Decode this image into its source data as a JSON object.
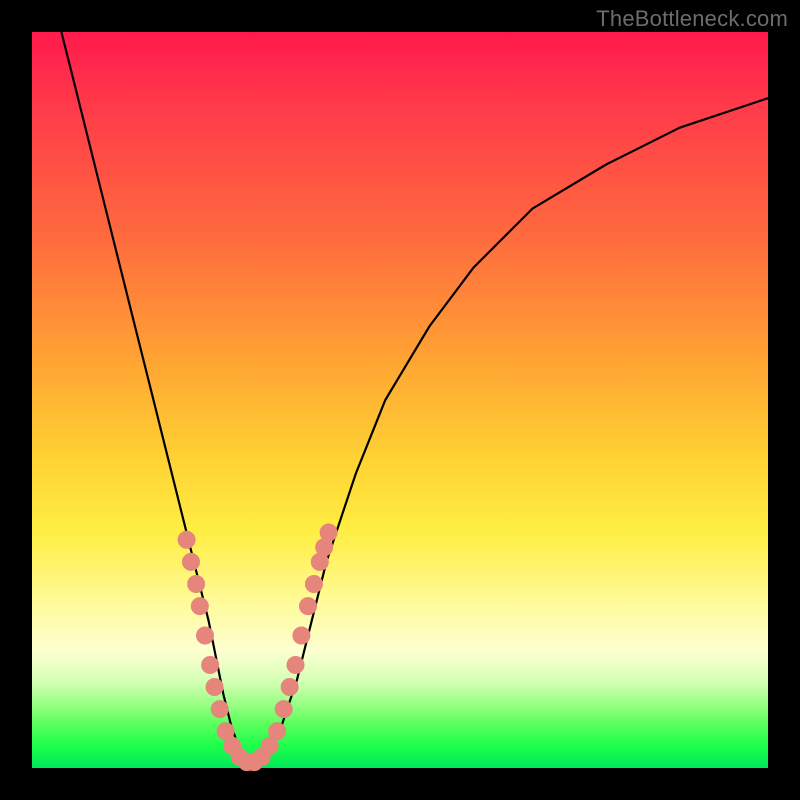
{
  "watermark": "TheBottleneck.com",
  "colors": {
    "page_bg": "#000000",
    "dot": "#e6857c",
    "curve": "#000000"
  },
  "chart_data": {
    "type": "line",
    "title": "",
    "xlabel": "",
    "ylabel": "",
    "xlim": [
      0,
      100
    ],
    "ylim": [
      0,
      100
    ],
    "grid": false,
    "legend": false,
    "series": [
      {
        "name": "bottleneck-curve",
        "x": [
          4,
          6,
          8,
          10,
          12,
          14,
          16,
          18,
          20,
          22,
          24,
          26,
          27,
          28,
          29,
          30,
          32,
          34,
          36,
          38,
          40,
          44,
          48,
          54,
          60,
          68,
          78,
          88,
          100
        ],
        "y": [
          100,
          92,
          84,
          76,
          68,
          60,
          52,
          44,
          36,
          28,
          20,
          10,
          6,
          3,
          1,
          0,
          2,
          6,
          12,
          20,
          28,
          40,
          50,
          60,
          68,
          76,
          82,
          87,
          91
        ]
      }
    ],
    "highlight_points": {
      "name": "marker-dots",
      "comment": "salmon dots clustered on both flanks of the V near the bottom",
      "points": [
        {
          "x": 21.0,
          "y": 31
        },
        {
          "x": 21.6,
          "y": 28
        },
        {
          "x": 22.3,
          "y": 25
        },
        {
          "x": 22.8,
          "y": 22
        },
        {
          "x": 23.5,
          "y": 18
        },
        {
          "x": 24.2,
          "y": 14
        },
        {
          "x": 24.8,
          "y": 11
        },
        {
          "x": 25.5,
          "y": 8
        },
        {
          "x": 26.3,
          "y": 5
        },
        {
          "x": 27.2,
          "y": 3
        },
        {
          "x": 28.2,
          "y": 1.5
        },
        {
          "x": 29.2,
          "y": 0.8
        },
        {
          "x": 30.2,
          "y": 0.8
        },
        {
          "x": 31.2,
          "y": 1.5
        },
        {
          "x": 32.3,
          "y": 3
        },
        {
          "x": 33.3,
          "y": 5
        },
        {
          "x": 34.2,
          "y": 8
        },
        {
          "x": 35.0,
          "y": 11
        },
        {
          "x": 35.8,
          "y": 14
        },
        {
          "x": 36.6,
          "y": 18
        },
        {
          "x": 37.5,
          "y": 22
        },
        {
          "x": 38.3,
          "y": 25
        },
        {
          "x": 39.1,
          "y": 28
        },
        {
          "x": 39.7,
          "y": 30
        },
        {
          "x": 40.3,
          "y": 32
        }
      ]
    }
  }
}
